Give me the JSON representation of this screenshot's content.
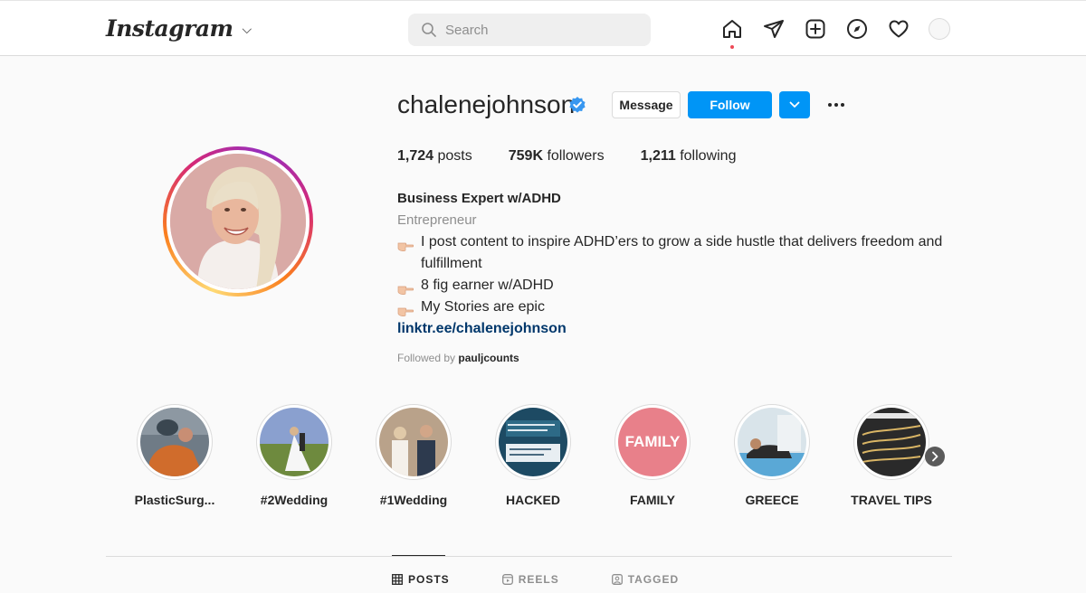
{
  "nav": {
    "logo": "Instagram",
    "search_placeholder": "Search",
    "icons": [
      "home-icon",
      "direct-icon",
      "new-post-icon",
      "explore-icon",
      "activity-icon"
    ]
  },
  "profile": {
    "username": "chalenejohnson",
    "verified": true,
    "message_label": "Message",
    "follow_label": "Follow",
    "stats": {
      "posts_count": "1,724",
      "posts_label": "posts",
      "followers_count": "759K",
      "followers_label": "followers",
      "following_count": "1,211",
      "following_label": "following"
    },
    "bio": {
      "name": "Business Expert w/ADHD",
      "category": "Entrepreneur",
      "line1": "I post content to inspire ADHD’ers to grow a side hustle that delivers freedom and fulfillment",
      "line2": "8 fig earner w/ADHD",
      "line3": "My Stories are epic",
      "link": "linktr.ee/chalenejohnson",
      "followed_prefix": "Followed by",
      "followed_by": "pauljcounts"
    }
  },
  "highlights": [
    {
      "label": "PlasticSurg..."
    },
    {
      "label": "#2Wedding"
    },
    {
      "label": "#1Wedding"
    },
    {
      "label": "HACKED"
    },
    {
      "label": "FAMILY",
      "cover_text": "FAMILY"
    },
    {
      "label": "GREECE"
    },
    {
      "label": "TRAVEL TIPS"
    }
  ],
  "tabs": [
    {
      "label": "POSTS",
      "active": true
    },
    {
      "label": "REELS",
      "active": false
    },
    {
      "label": "TAGGED",
      "active": false
    }
  ],
  "colors": {
    "accent": "#0095f6",
    "link": "#00376b",
    "notification": "#ed4956",
    "verified": "#3897f0"
  }
}
